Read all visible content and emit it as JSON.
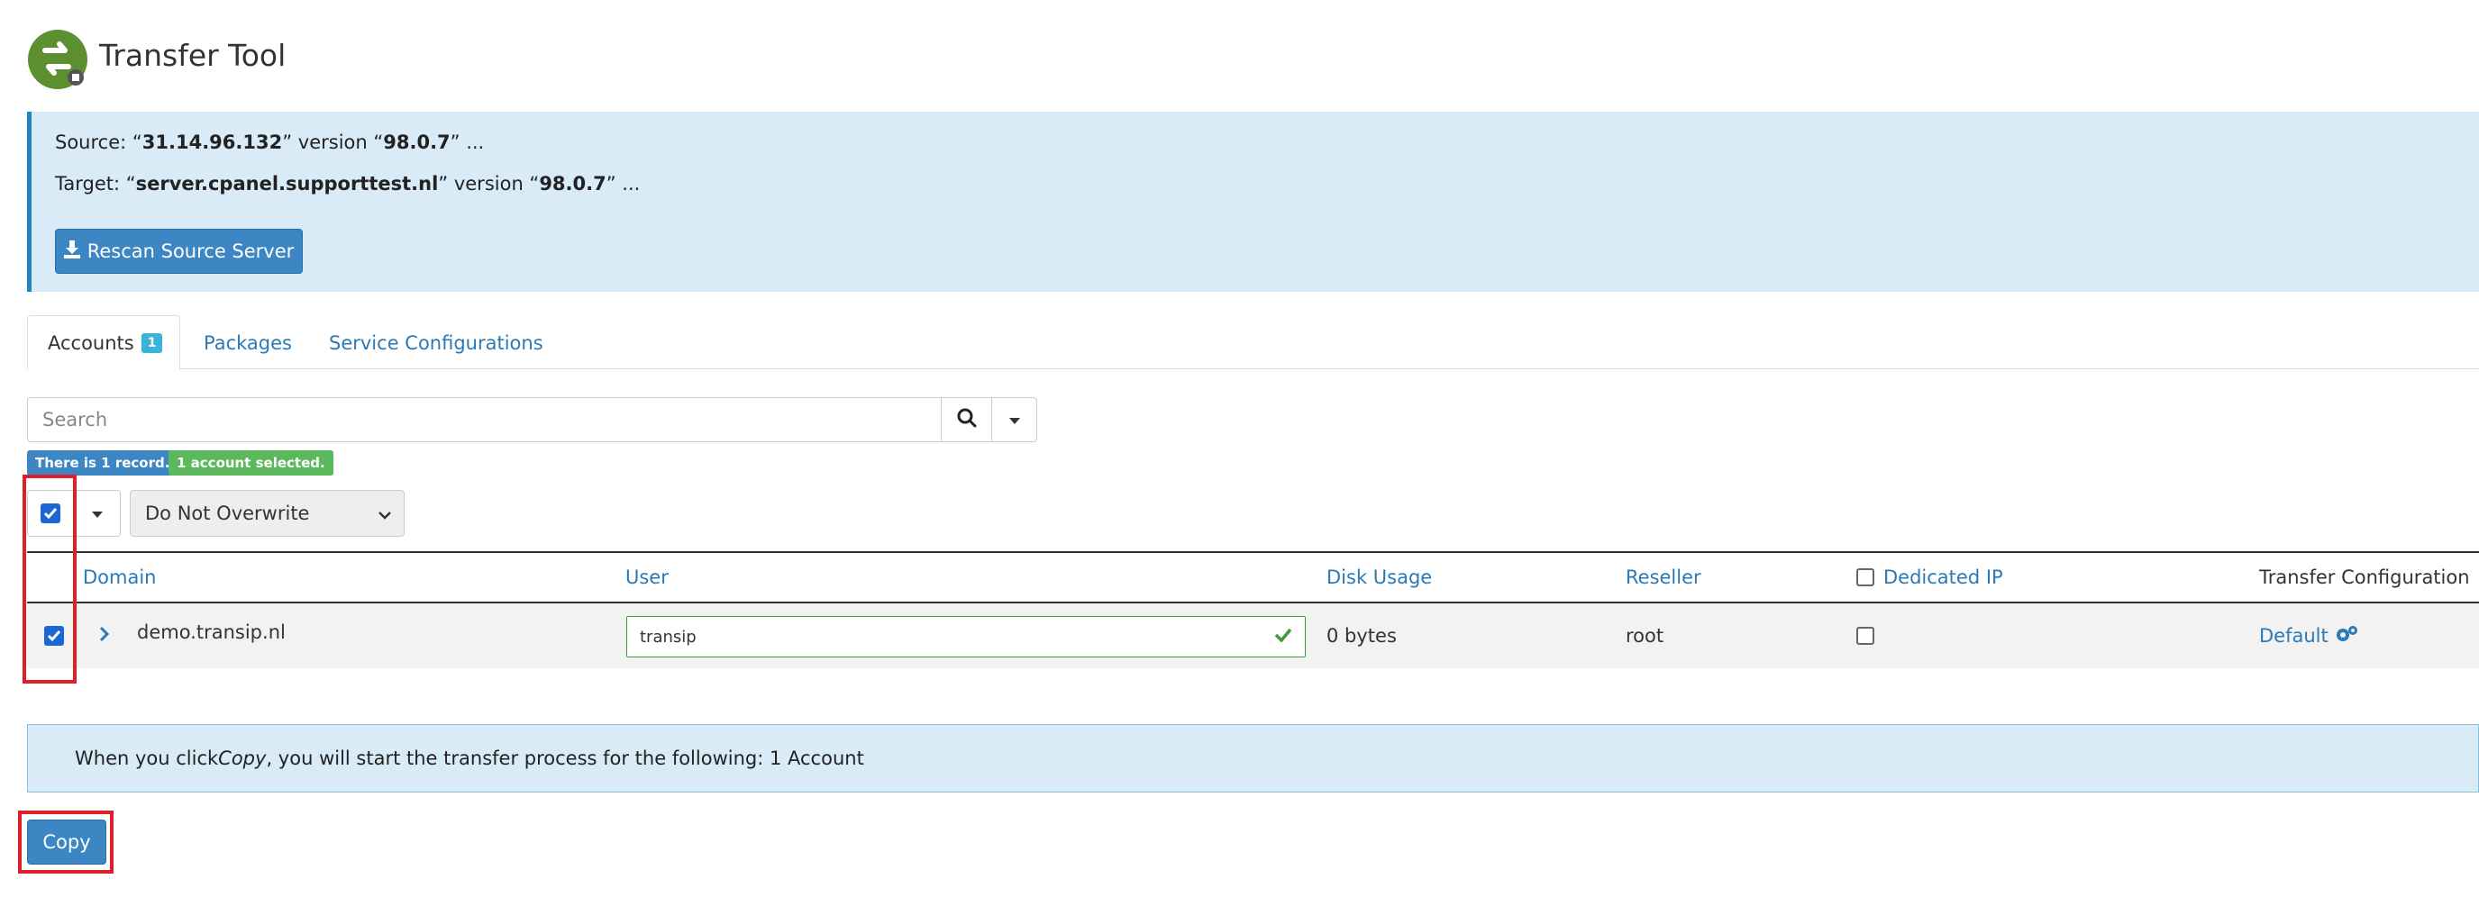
{
  "header": {
    "title": "Transfer Tool",
    "logo_icon": "transfer-tool-logo-icon"
  },
  "info": {
    "source_prefix": "Source: “",
    "source_host": "31.14.96.132",
    "source_mid": "” version “",
    "source_version": "98.0.7",
    "source_suffix": "” ...",
    "target_prefix": "Target: “",
    "target_host": "server.cpanel.supporttest.nl",
    "target_mid": "” version “",
    "target_version": "98.0.7",
    "target_suffix": "” ...",
    "rescan_label": "Rescan Source Server"
  },
  "tabs": [
    {
      "label": "Accounts",
      "badge": "1"
    },
    {
      "label": "Packages"
    },
    {
      "label": "Service Configurations"
    }
  ],
  "search": {
    "placeholder": "Search"
  },
  "status": {
    "records": "There is 1 record.",
    "selected": "1 account selected."
  },
  "toolbar": {
    "overwrite_value": "Do Not Overwrite"
  },
  "table": {
    "headers": [
      "Domain",
      "User",
      "Disk Usage",
      "Reseller",
      "Dedicated IP",
      "Transfer Configuration"
    ],
    "rows": [
      {
        "domain": "demo.transip.nl",
        "user": "transip",
        "disk": "0 bytes",
        "reseller": "root",
        "config": "Default"
      }
    ]
  },
  "notice": {
    "prefix": "When you click ",
    "action": "Copy",
    "suffix": ", you will start the transfer process for the following: 1 Account"
  },
  "actions": {
    "copy_label": "Copy"
  },
  "colors": {
    "primary": "#3c86c3",
    "info_bg": "#d8ebf7",
    "success": "#5cb85c",
    "annotation": "#e01e2a"
  }
}
